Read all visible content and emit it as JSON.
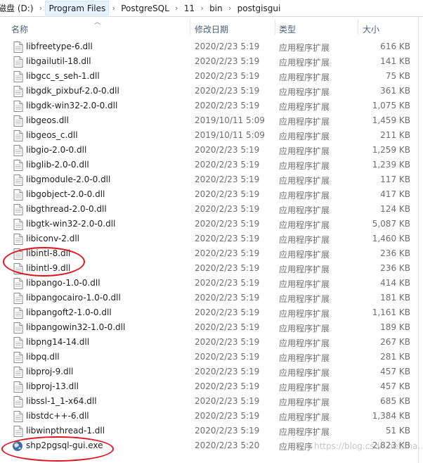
{
  "breadcrumb": [
    "磁盘 (D:)",
    "Program Files",
    "PostgreSQL",
    "11",
    "bin",
    "postgisgui"
  ],
  "columns": {
    "name": "名称",
    "date": "修改日期",
    "type": "类型",
    "size": "大小"
  },
  "files": [
    {
      "name": "libfreetype-6.dll",
      "date": "2020/2/23 5:19",
      "type": "应用程序扩展",
      "size": "616 KB",
      "icon": "dll-file-icon"
    },
    {
      "name": "libgailutil-18.dll",
      "date": "2020/2/23 5:19",
      "type": "应用程序扩展",
      "size": "141 KB",
      "icon": "dll-file-icon"
    },
    {
      "name": "libgcc_s_seh-1.dll",
      "date": "2020/2/23 5:19",
      "type": "应用程序扩展",
      "size": "75 KB",
      "icon": "dll-file-icon"
    },
    {
      "name": "libgdk_pixbuf-2.0-0.dll",
      "date": "2020/2/23 5:19",
      "type": "应用程序扩展",
      "size": "361 KB",
      "icon": "dll-file-icon"
    },
    {
      "name": "libgdk-win32-2.0-0.dll",
      "date": "2020/2/23 5:19",
      "type": "应用程序扩展",
      "size": "1,075 KB",
      "icon": "dll-file-icon"
    },
    {
      "name": "libgeos.dll",
      "date": "2019/10/11 5:09",
      "type": "应用程序扩展",
      "size": "1,459 KB",
      "icon": "dll-file-icon"
    },
    {
      "name": "libgeos_c.dll",
      "date": "2019/10/11 5:09",
      "type": "应用程序扩展",
      "size": "211 KB",
      "icon": "dll-file-icon"
    },
    {
      "name": "libgio-2.0-0.dll",
      "date": "2020/2/23 5:19",
      "type": "应用程序扩展",
      "size": "1,259 KB",
      "icon": "dll-file-icon"
    },
    {
      "name": "libglib-2.0-0.dll",
      "date": "2020/2/23 5:19",
      "type": "应用程序扩展",
      "size": "1,239 KB",
      "icon": "dll-file-icon"
    },
    {
      "name": "libgmodule-2.0-0.dll",
      "date": "2020/2/23 5:19",
      "type": "应用程序扩展",
      "size": "117 KB",
      "icon": "dll-file-icon"
    },
    {
      "name": "libgobject-2.0-0.dll",
      "date": "2020/2/23 5:19",
      "type": "应用程序扩展",
      "size": "417 KB",
      "icon": "dll-file-icon"
    },
    {
      "name": "libgthread-2.0-0.dll",
      "date": "2020/2/23 5:19",
      "type": "应用程序扩展",
      "size": "124 KB",
      "icon": "dll-file-icon"
    },
    {
      "name": "libgtk-win32-2.0-0.dll",
      "date": "2020/2/23 5:19",
      "type": "应用程序扩展",
      "size": "5,087 KB",
      "icon": "dll-file-icon"
    },
    {
      "name": "libiconv-2.dll",
      "date": "2020/2/23 5:19",
      "type": "应用程序扩展",
      "size": "1,460 KB",
      "icon": "dll-file-icon"
    },
    {
      "name": "libintl-8.dll",
      "date": "2020/2/23 5:19",
      "type": "应用程序扩展",
      "size": "236 KB",
      "icon": "dll-file-icon"
    },
    {
      "name": "libintl-9.dll",
      "date": "2020/2/23 5:19",
      "type": "应用程序扩展",
      "size": "236 KB",
      "icon": "dll-file-icon"
    },
    {
      "name": "libpango-1.0-0.dll",
      "date": "2020/2/23 5:19",
      "type": "应用程序扩展",
      "size": "414 KB",
      "icon": "dll-file-icon"
    },
    {
      "name": "libpangocairo-1.0-0.dll",
      "date": "2020/2/23 5:19",
      "type": "应用程序扩展",
      "size": "181 KB",
      "icon": "dll-file-icon"
    },
    {
      "name": "libpangoft2-1.0-0.dll",
      "date": "2020/2/23 5:19",
      "type": "应用程序扩展",
      "size": "1,161 KB",
      "icon": "dll-file-icon"
    },
    {
      "name": "libpangowin32-1.0-0.dll",
      "date": "2020/2/23 5:19",
      "type": "应用程序扩展",
      "size": "189 KB",
      "icon": "dll-file-icon"
    },
    {
      "name": "libpng14-14.dll",
      "date": "2020/2/23 5:19",
      "type": "应用程序扩展",
      "size": "267 KB",
      "icon": "dll-file-icon"
    },
    {
      "name": "libpq.dll",
      "date": "2020/2/23 5:19",
      "type": "应用程序扩展",
      "size": "281 KB",
      "icon": "dll-file-icon"
    },
    {
      "name": "libproj-9.dll",
      "date": "2020/2/23 5:19",
      "type": "应用程序扩展",
      "size": "457 KB",
      "icon": "dll-file-icon"
    },
    {
      "name": "libproj-13.dll",
      "date": "2020/2/23 5:19",
      "type": "应用程序扩展",
      "size": "457 KB",
      "icon": "dll-file-icon"
    },
    {
      "name": "libssl-1_1-x64.dll",
      "date": "2020/2/23 5:19",
      "type": "应用程序扩展",
      "size": "685 KB",
      "icon": "dll-file-icon"
    },
    {
      "name": "libstdc++-6.dll",
      "date": "2020/2/23 5:19",
      "type": "应用程序扩展",
      "size": "1,384 KB",
      "icon": "dll-file-icon"
    },
    {
      "name": "libwinpthread-1.dll",
      "date": "2020/2/23 5:19",
      "type": "应用程序扩展",
      "size": "51 KB",
      "icon": "dll-file-icon"
    },
    {
      "name": "shp2pgsql-gui.exe",
      "date": "2020/2/23 5:20",
      "type": "应用程序",
      "size": "2,823 KB",
      "icon": "globe-exe-icon"
    }
  ],
  "watermark": "https://blog.csdn.net/ma...ha_",
  "colors": {
    "annotation": "#e0141e",
    "header_text": "#4c607a",
    "breadcrumb_highlight": "#e5f3ff"
  }
}
